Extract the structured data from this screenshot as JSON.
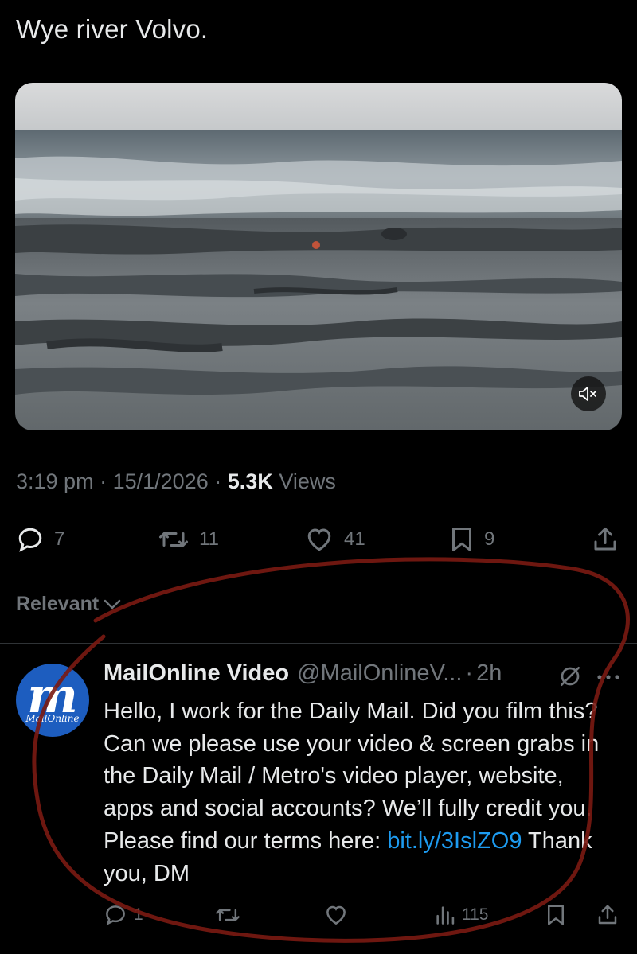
{
  "tweet": {
    "text": "Wye river Volvo.",
    "time": "3:19 pm",
    "separator1": "·",
    "date": "15/1/2026",
    "separator2": "·",
    "views_count": "5.3K",
    "views_label": "Views"
  },
  "media": {
    "type": "video",
    "mute_icon": "speaker-muted-icon"
  },
  "actions": {
    "replies": "7",
    "reposts": "11",
    "likes": "41",
    "bookmarks": "9"
  },
  "sort": {
    "label": "Relevant"
  },
  "reply": {
    "name": "MailOnline Video",
    "handle": "@MailOnlineV...",
    "dot": "·",
    "time": "2h",
    "avatar_letter": "m",
    "avatar_brand": "MailOnline",
    "text_main": "Hello, I work for the Daily Mail. Did you film this? Can we please use your video & screen grabs in the Daily Mail / Metro's video player, website, apps and social accounts? We’ll fully credit you. Please find our terms here: ",
    "link": "bit.ly/3IslZO9",
    "text_end": " Thank you, DM",
    "replies": "1",
    "views": "115"
  },
  "colors": {
    "background": "#000000",
    "text": "#e7e9ea",
    "secondary": "#71767b",
    "link": "#1d9bf0",
    "annotation": "#8b1a12"
  }
}
